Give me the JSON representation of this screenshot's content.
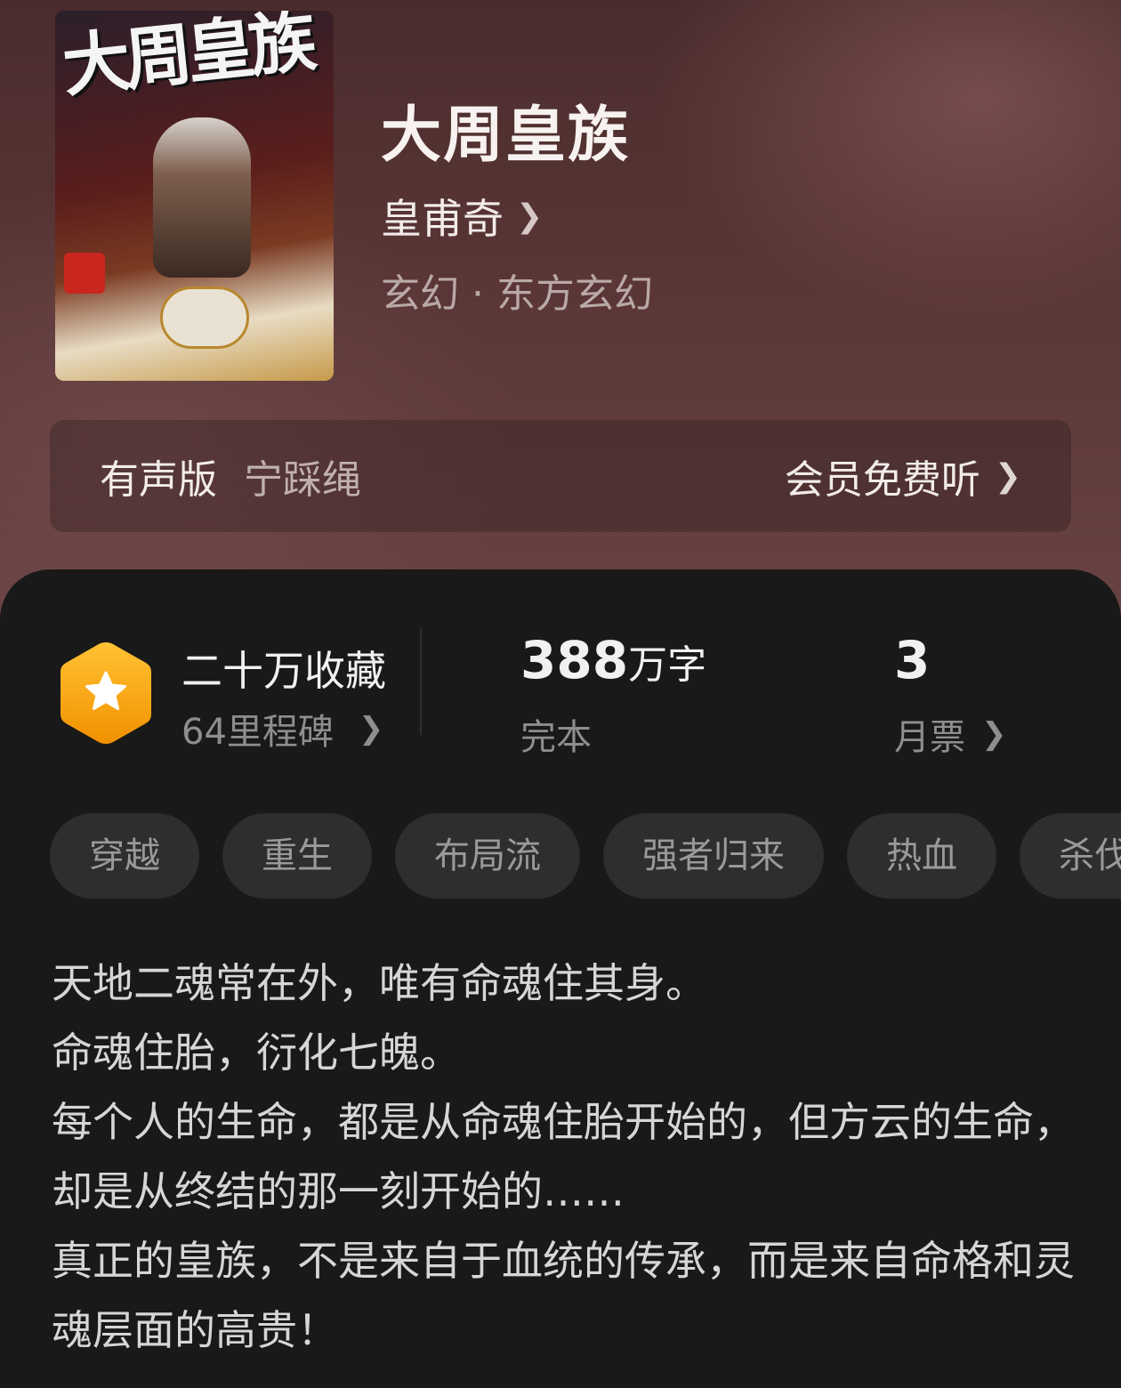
{
  "book": {
    "cover_text": "大周皇族",
    "title": "大周皇族",
    "author": "皇甫奇",
    "genre": "玄幻 · 东方玄幻"
  },
  "audio": {
    "label": "有声版",
    "narrator": "宁踩绳",
    "action": "会员免费听"
  },
  "stats": {
    "favorites": "二十万收藏",
    "milestones": "64里程碑",
    "word_count": "388",
    "word_unit": "万字",
    "status": "完本",
    "monthly_tickets": "3",
    "monthly_tickets_label": "月票"
  },
  "tags": [
    "穿越",
    "重生",
    "布局流",
    "强者归来",
    "热血",
    "杀伐"
  ],
  "intro": [
    "天地二魂常在外，唯有命魂住其身。",
    "命魂住胎，衍化七魄。",
    "每个人的生命，都是从命魂住胎开始的，但方云的生命，却是从终结的那一刻开始的……",
    "真正的皇族，不是来自于血统的传承，而是来自命格和灵魂层面的高贵！"
  ],
  "icons": {
    "chevron": "chevron-right-icon",
    "badge": "star-hexagon-icon"
  },
  "colors": {
    "badge": "#f7a300",
    "panel_bg": "#191919",
    "tag_bg": "#2e2e2e"
  }
}
